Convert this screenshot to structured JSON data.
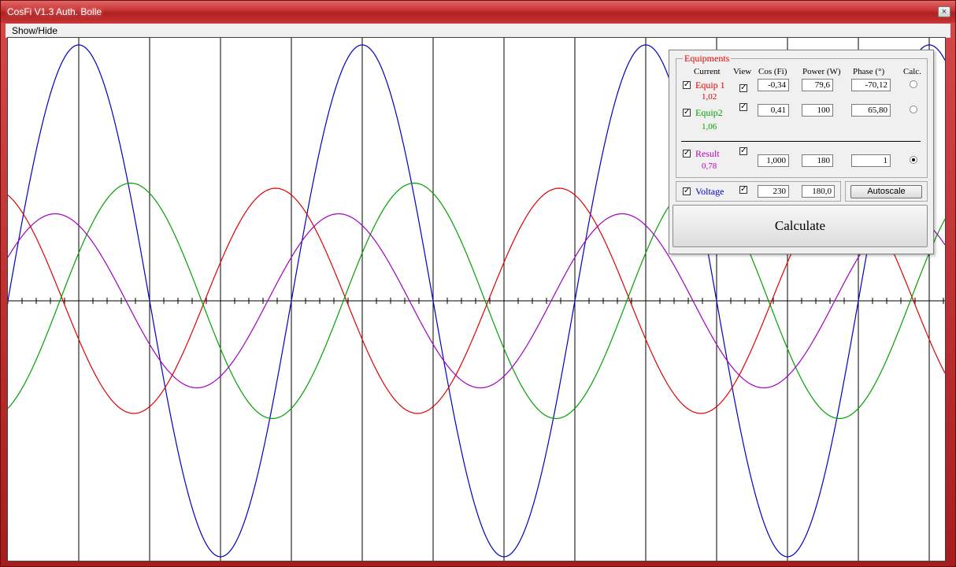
{
  "window": {
    "title": "CosFi V1.3 Auth. Bolle",
    "close_label": "×"
  },
  "menu": {
    "show_hide": "Show/Hide"
  },
  "panel": {
    "group_title": "Equipments",
    "headers": {
      "current": "Current",
      "view": "View",
      "cos": "Cos (Fi)",
      "power": "Power (W)",
      "phase": "Phase (°)",
      "calc": "Calc."
    },
    "equip1": {
      "name": "Equip 1",
      "current": "1,02",
      "checked": true,
      "view": true,
      "cos": "-0,34",
      "power": "79,6",
      "phase": "-70,12",
      "calc_selected": false,
      "color": "#e00000"
    },
    "equip2": {
      "name": "Equip2",
      "current": "1,06",
      "checked": true,
      "view": true,
      "cos": "0,41",
      "power": "100",
      "phase": "65,80",
      "calc_selected": false,
      "color": "#00a000"
    },
    "result": {
      "name": "Result",
      "current": "0,78",
      "checked": true,
      "view": true,
      "cos": "1,000",
      "power": "180",
      "phase": "1",
      "calc_selected": true,
      "color": "#c000c0"
    },
    "voltage": {
      "name": "Voltage",
      "checked": true,
      "view": true,
      "value": "230",
      "value2": "180,0",
      "color": "#0000c0"
    },
    "autoscale_label": "Autoscale",
    "calculate_label": "Calculate"
  },
  "chart_data": {
    "type": "line",
    "title": "",
    "xlabel": "",
    "ylabel": "",
    "grid": "vertical lines",
    "period_divisions": 4,
    "series": [
      {
        "name": "Voltage",
        "color": "#0000c0",
        "amplitude": 1.0,
        "phase_deg": 0
      },
      {
        "name": "Equip 1",
        "color": "#e00000",
        "amplitude": 0.44,
        "phase_deg": 110
      },
      {
        "name": "Equip2",
        "color": "#00a000",
        "amplitude": 0.46,
        "phase_deg": -66
      },
      {
        "name": "Result",
        "color": "#a000c0",
        "amplitude": 0.34,
        "phase_deg": 30
      }
    ],
    "cycles_shown": 3.3
  }
}
